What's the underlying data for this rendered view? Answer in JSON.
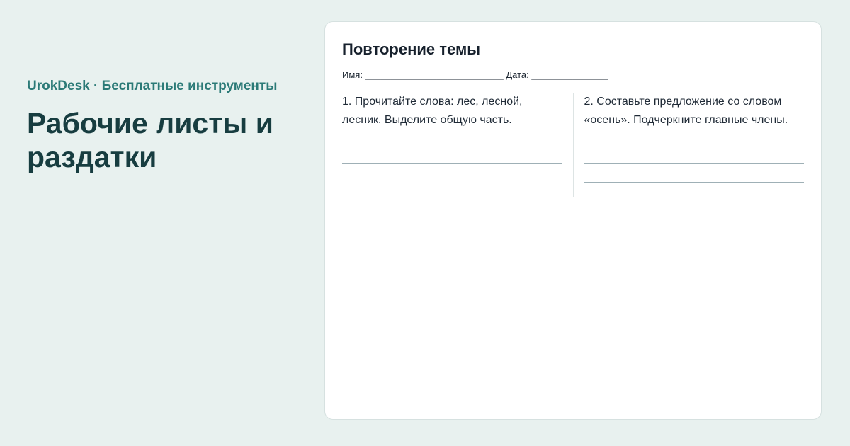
{
  "hero": {
    "brand": "UrokDesk · Бесплатные инструменты",
    "title": "Рабочие листы и раздатки"
  },
  "worksheet": {
    "title": "Повторение темы",
    "meta": "Имя: ___________________________ Дата: _______________",
    "tasks": [
      {
        "text": "1. Прочитайте слова: лес, лесной, лесник. Выделите общую часть.",
        "answer_lines": 2
      },
      {
        "text": "2. Составьте предложение со словом «осень». Подчеркните главные члены.",
        "answer_lines": 3
      }
    ]
  },
  "colors": {
    "background": "#e8f1ef",
    "brand": "#2b7a77",
    "hero_title": "#173d40",
    "card": "#ffffff"
  }
}
